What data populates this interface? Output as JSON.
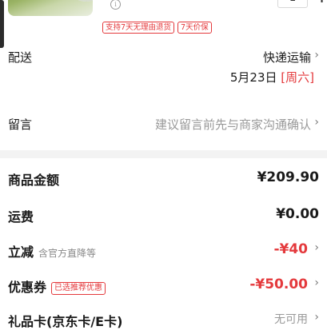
{
  "product": {
    "info_icon": "i",
    "quantity": "1",
    "minus_icon": "minus-icon",
    "plus_icon": "+",
    "badges": [
      "支持7天无理由退货",
      "7天价保"
    ]
  },
  "delivery": {
    "label": "配送",
    "method": "快递运输",
    "date": "5月23日",
    "weekday": "[周六]"
  },
  "message": {
    "label": "留言",
    "placeholder": "建议留言前先与商家沟通确认"
  },
  "summary": {
    "goods_amount": {
      "label": "商品金额",
      "value": "¥209.90"
    },
    "freight": {
      "label": "运费",
      "value": "¥0.00"
    },
    "instant_discount": {
      "label": "立减",
      "note": "含官方直降等",
      "value": "-¥40"
    },
    "coupon": {
      "label": "优惠券",
      "tag": "已选推荐优惠",
      "value": "-¥50.00"
    },
    "gift_card": {
      "label": "礼品卡(京东卡/E卡)",
      "value": "无可用"
    }
  },
  "icons": {
    "chevron": "›"
  },
  "colors": {
    "accent_red": "#e4393c",
    "muted_gray": "#999999",
    "divider_gray": "#f3f3f3"
  }
}
